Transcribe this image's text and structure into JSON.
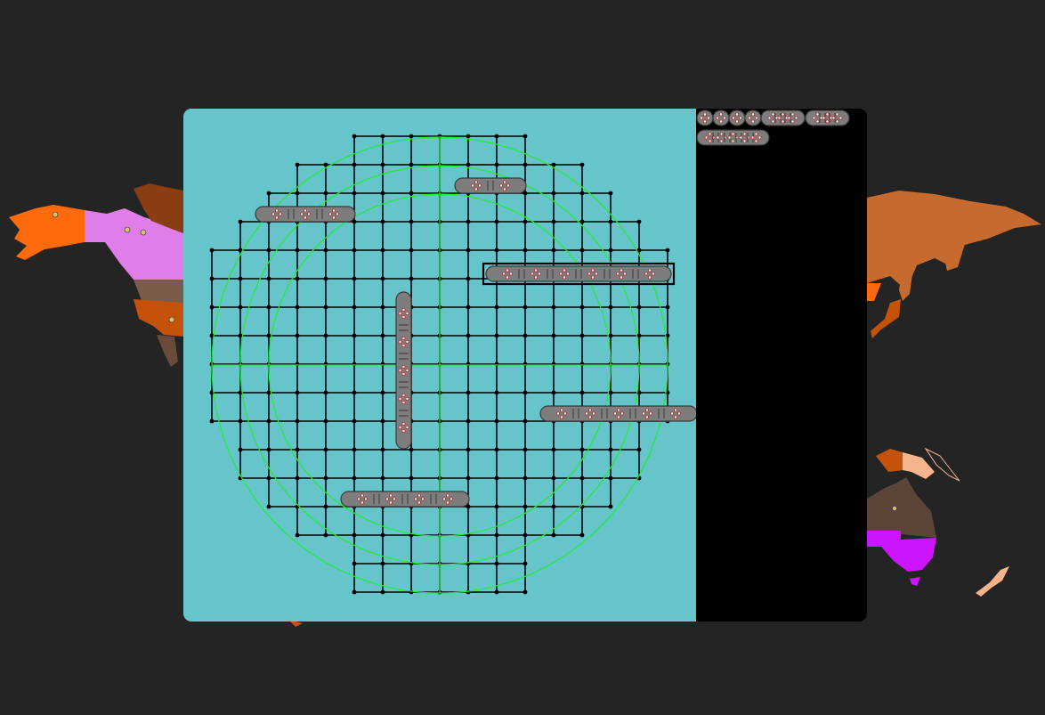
{
  "game": {
    "mode": "ship placement",
    "board": {
      "shape": "circular",
      "grid_columns": 17,
      "grid_rows": 17,
      "background": "#66c4cb",
      "grid_color": "#000000",
      "ring_color": "#22ee33",
      "ring_count": 3
    },
    "ships_on_board": [
      {
        "id": "ship-a",
        "length": 2,
        "orientation": "horizontal",
        "selected": false
      },
      {
        "id": "ship-b",
        "length": 3,
        "orientation": "horizontal",
        "selected": false
      },
      {
        "id": "ship-c",
        "length": 6,
        "orientation": "horizontal",
        "selected": true
      },
      {
        "id": "ship-d",
        "length": 5,
        "orientation": "vertical",
        "selected": false
      },
      {
        "id": "ship-e",
        "length": 5,
        "orientation": "horizontal",
        "selected": false
      },
      {
        "id": "ship-f",
        "length": 4,
        "orientation": "horizontal",
        "selected": false
      }
    ],
    "tray_ships": [
      {
        "id": "tray-1",
        "length": 1
      },
      {
        "id": "tray-2",
        "length": 1
      },
      {
        "id": "tray-3",
        "length": 1
      },
      {
        "id": "tray-4",
        "length": 1
      },
      {
        "id": "tray-5",
        "length": 3
      },
      {
        "id": "tray-6",
        "length": 3
      },
      {
        "id": "tray-7",
        "length": 5
      }
    ],
    "colors": {
      "page_background": "#242424",
      "tray_background": "#000000",
      "ship_fill": "#7d7d7d",
      "selection_outline": "#000000"
    }
  },
  "map": {
    "visible_regions": [
      "north-america",
      "asia",
      "oceania"
    ],
    "star_markers": 5
  }
}
